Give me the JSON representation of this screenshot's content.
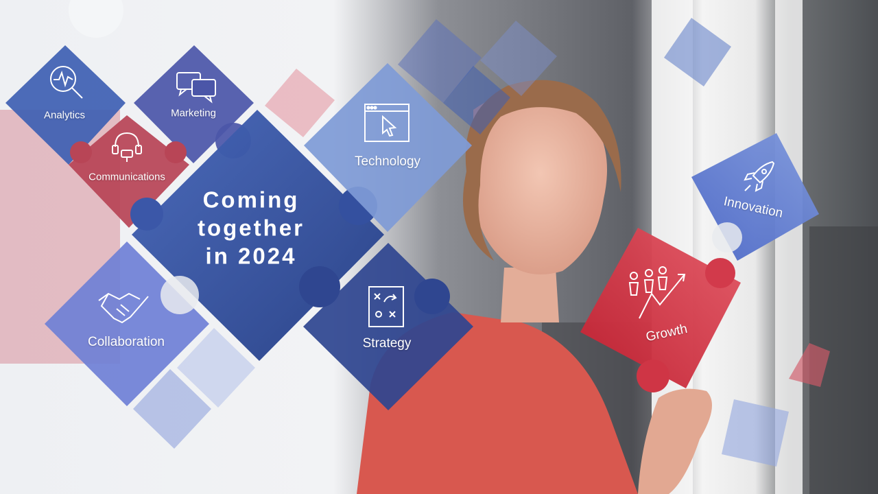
{
  "headline": {
    "line1": "Coming",
    "line2": "together",
    "line3": "in 2024"
  },
  "tiles": {
    "analytics": {
      "label": "Analytics",
      "icon": "magnifier-chart-icon",
      "color": "#3e5fb3"
    },
    "marketing": {
      "label": "Marketing",
      "icon": "speech-bubbles-icon",
      "color": "#4b56a8"
    },
    "communications": {
      "label": "Communications",
      "icon": "headset-icon",
      "color": "#b84556"
    },
    "technology": {
      "label": "Technology",
      "icon": "browser-cursor-icon",
      "color": "#7f9bd6"
    },
    "collaboration": {
      "label": "Collaboration",
      "icon": "handshake-icon",
      "color": "#6f80d6"
    },
    "strategy": {
      "label": "Strategy",
      "icon": "strategy-board-icon",
      "color": "#2f4690"
    },
    "innovation": {
      "label": "Innovation",
      "icon": "rocket-icon",
      "color": "#5a78cf"
    },
    "growth": {
      "label": "Growth",
      "icon": "people-growth-icon",
      "color": "#d93a4a"
    }
  },
  "colors": {
    "center_tile": "#34509f",
    "accent_red": "#d93a4a",
    "accent_blue": "#3e5fb3",
    "shirt": "#d8584f"
  }
}
